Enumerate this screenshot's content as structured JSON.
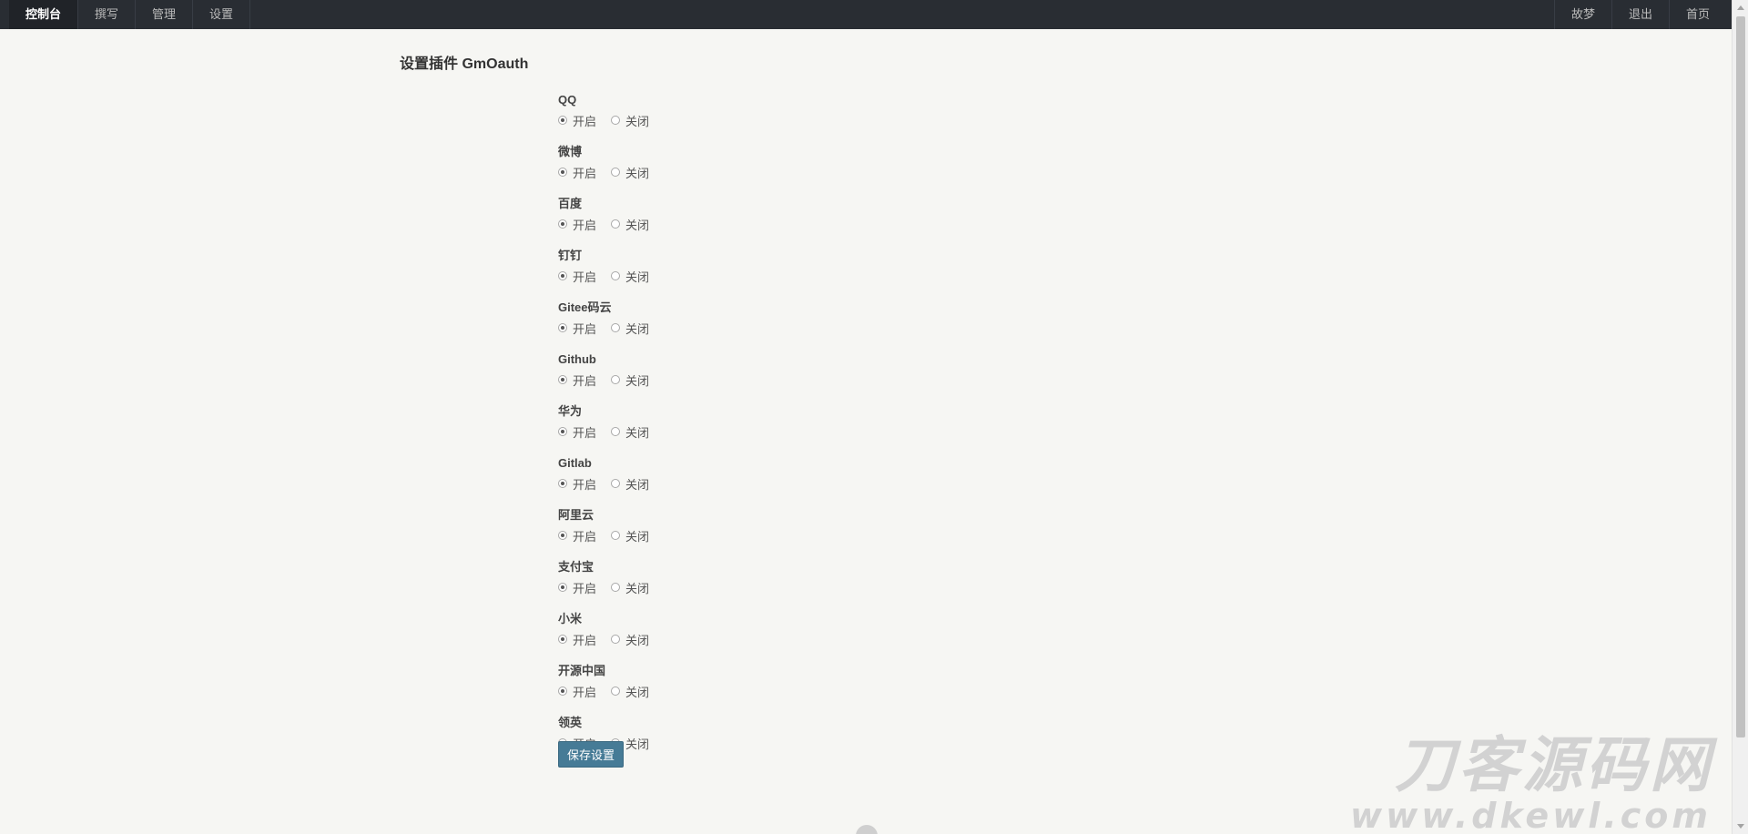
{
  "topbar": {
    "left_items": [
      {
        "label": "控制台",
        "active": true
      },
      {
        "label": "撰写",
        "active": false
      },
      {
        "label": "管理",
        "active": false
      },
      {
        "label": "设置",
        "active": false
      }
    ],
    "right_items": [
      {
        "label": "故梦"
      },
      {
        "label": "退出"
      },
      {
        "label": "首页"
      }
    ]
  },
  "page": {
    "title": "设置插件 GmOauth"
  },
  "form": {
    "on_label": "开启",
    "off_label": "关闭",
    "fields": [
      {
        "label": "QQ",
        "value": "on"
      },
      {
        "label": "微博",
        "value": "on"
      },
      {
        "label": "百度",
        "value": "on"
      },
      {
        "label": "钉钉",
        "value": "on"
      },
      {
        "label": "Gitee码云",
        "value": "on"
      },
      {
        "label": "Github",
        "value": "on"
      },
      {
        "label": "华为",
        "value": "on"
      },
      {
        "label": "Gitlab",
        "value": "on"
      },
      {
        "label": "阿里云",
        "value": "on"
      },
      {
        "label": "支付宝",
        "value": "on"
      },
      {
        "label": "小米",
        "value": "on"
      },
      {
        "label": "开源中国",
        "value": "on"
      },
      {
        "label": "领英",
        "value": "on"
      }
    ],
    "save_label": "保存设置"
  },
  "watermark": {
    "title": "刀客源码网",
    "url": "www.dkewl.com"
  },
  "colors": {
    "topbar_bg": "#292d33",
    "page_bg": "#f6f6f3",
    "button_bg": "#467b96"
  }
}
